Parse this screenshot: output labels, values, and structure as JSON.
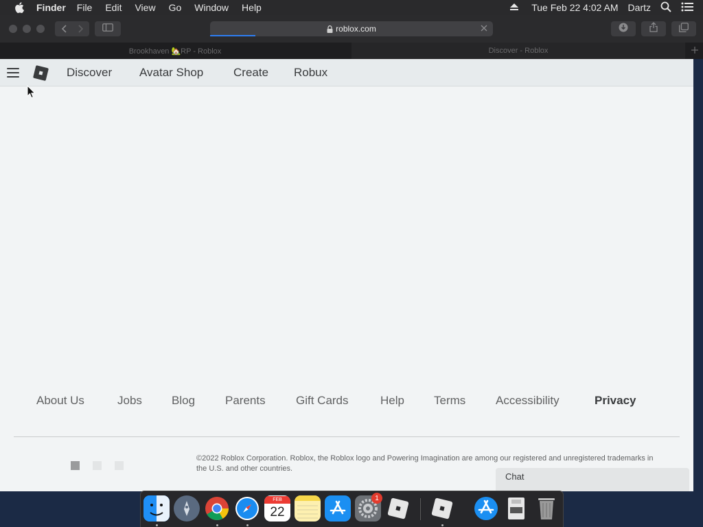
{
  "menubar": {
    "app_name": "Finder",
    "menus": [
      "File",
      "Edit",
      "View",
      "Go",
      "Window",
      "Help"
    ],
    "clock": "Tue Feb 22  4:02 AM",
    "user": "Dartz",
    "icons": [
      "apple-icon",
      "eject-icon",
      "spotlight-search-icon",
      "control-center-icon"
    ]
  },
  "browser": {
    "address": "roblox.com",
    "load_progress": 0.16,
    "tabs": [
      {
        "title": "Brookhaven 🏡RP - Roblox",
        "active": false
      },
      {
        "title": "Discover - Roblox",
        "active": true
      }
    ],
    "toolbar_icons": [
      "back-icon",
      "forward-icon",
      "sidebar-icon",
      "lock-icon",
      "download-icon",
      "share-icon",
      "tab-overview-icon",
      "new-tab-icon"
    ]
  },
  "nav": {
    "links": [
      "Discover",
      "Avatar Shop",
      "Create",
      "Robux"
    ],
    "icons": [
      "menu-icon",
      "roblox-logo-icon"
    ]
  },
  "footer": {
    "links": [
      "About Us",
      "Jobs",
      "Blog",
      "Parents",
      "Gift Cards",
      "Help",
      "Terms",
      "Accessibility",
      "Privacy"
    ],
    "bold_link": "Privacy",
    "copyright": "©2022 Roblox Corporation. Roblox, the Roblox logo and Powering Imagination are among our registered and unregistered trademarks in the U.S. and other countries."
  },
  "chat": {
    "label": "Chat"
  },
  "dock": {
    "icons": [
      "finder-icon",
      "launchpad-icon",
      "chrome-icon",
      "safari-icon",
      "calendar-icon",
      "notes-icon",
      "app-store-icon",
      "system-preferences-icon",
      "roblox-icon",
      "roblox-studio-icon",
      "app-store-downloads-icon",
      "disk-utility-icon",
      "trash-icon"
    ],
    "calendar": {
      "month": "FEB",
      "day": "22"
    },
    "system_preferences_badge": "1"
  },
  "colors": {
    "accent": "#2d7ef5",
    "text_primary": "#393b3d",
    "text_secondary": "#606162",
    "page_background": "#f2f4f5"
  }
}
